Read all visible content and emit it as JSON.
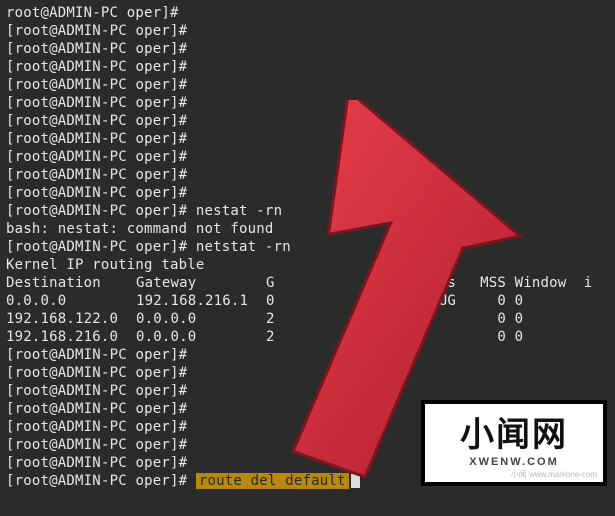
{
  "prompt": {
    "user": "root",
    "host": "ADMIN-PC",
    "path": "oper",
    "symbol": "#"
  },
  "lines": {
    "partial_top": "root@ADMIN-PC oper]#",
    "nestat_cmd": "nestat -rn",
    "nestat_err": "bash: nestat: command not found",
    "netstat_cmd": "netstat -rn",
    "table_title": "Kernel IP routing table",
    "route_cmd": "route del default"
  },
  "table": {
    "headers": {
      "dest": "Destination",
      "gw": "Gateway",
      "g": "G",
      "flags": "Flags",
      "mss": "MSS",
      "win": "Window",
      "i": "i"
    },
    "rows": [
      {
        "dest": "0.0.0.0",
        "gw": "192.168.216.1",
        "g": "0",
        "flags": "UG",
        "mss": "0",
        "win": "0"
      },
      {
        "dest": "192.168.122.0",
        "gw": "0.0.0.0",
        "g": "2",
        "flags": "",
        "mss": "0",
        "win": "0"
      },
      {
        "dest": "192.168.216.0",
        "gw": "0.0.0.0",
        "g": "2",
        "flags": "",
        "mss": "0",
        "win": "0"
      }
    ]
  },
  "watermark": {
    "main": "小闻网",
    "sub": "XWENW.COM",
    "credit": "小闻 www.markone-com"
  }
}
